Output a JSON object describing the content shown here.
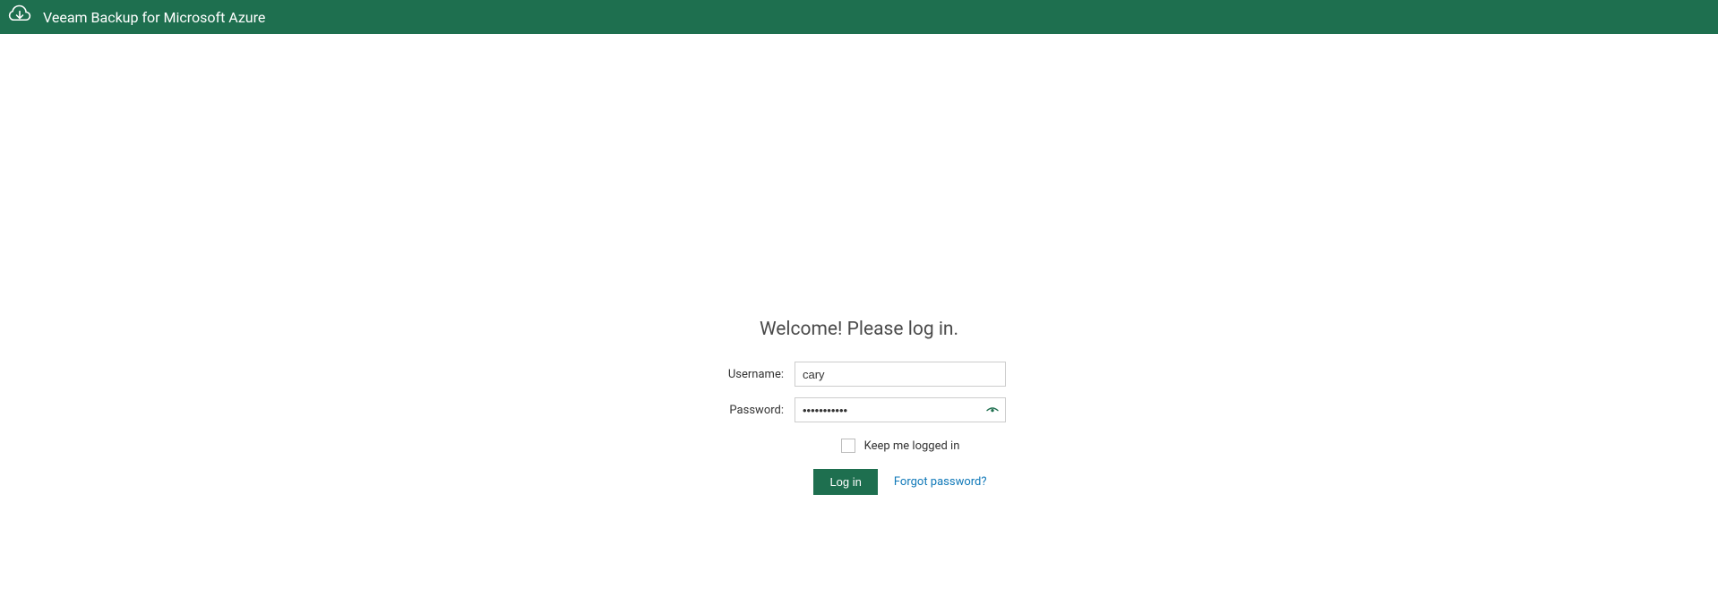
{
  "header": {
    "title": "Veeam Backup for Microsoft Azure"
  },
  "login": {
    "welcome_heading": "Welcome! Please log in.",
    "username_label": "Username:",
    "username_value": "cary",
    "password_label": "Password:",
    "password_value": "•••••••••••",
    "keep_logged_in_label": "Keep me logged in",
    "login_button_label": "Log in",
    "forgot_password_label": "Forgot password?"
  }
}
